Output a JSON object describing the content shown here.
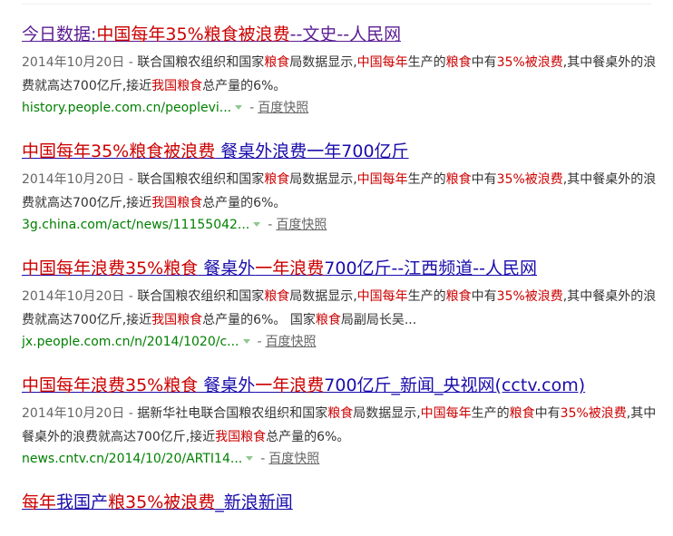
{
  "results": [
    {
      "title_parts": [
        {
          "text": "今日数据:",
          "hl": false
        },
        {
          "text": "中国每年35%粮食被浪费",
          "hl": true
        },
        {
          "text": "--文史--人民网",
          "hl": false
        }
      ],
      "visited": true,
      "abstract_parts": [
        {
          "text": "2014年10月20日 - ",
          "cls": "date"
        },
        {
          "text": "联合国粮农组织和国家",
          "cls": ""
        },
        {
          "text": "粮食",
          "cls": "hl"
        },
        {
          "text": "局数据显示,",
          "cls": ""
        },
        {
          "text": "中国每年",
          "cls": "hl"
        },
        {
          "text": "生产的",
          "cls": ""
        },
        {
          "text": "粮食",
          "cls": "hl"
        },
        {
          "text": "中有",
          "cls": ""
        },
        {
          "text": "35%被浪费",
          "cls": "hl"
        },
        {
          "text": ",其中餐桌外的浪费就高达700亿斤,接近",
          "cls": ""
        },
        {
          "text": "我国粮食",
          "cls": "hl"
        },
        {
          "text": "总产量的6%。",
          "cls": ""
        }
      ],
      "url": "history.people.com.cn/peoplevi...",
      "cache_label": "百度快照"
    },
    {
      "title_parts": [
        {
          "text": "中国每年35%粮食被浪费",
          "hl": true
        },
        {
          "text": " 餐桌外浪费一年700亿斤",
          "hl": false
        }
      ],
      "visited": false,
      "abstract_parts": [
        {
          "text": "2014年10月20日 - ",
          "cls": "date"
        },
        {
          "text": "联合国粮农组织和国家",
          "cls": ""
        },
        {
          "text": "粮食",
          "cls": "hl"
        },
        {
          "text": "局数据显示,",
          "cls": ""
        },
        {
          "text": "中国每年",
          "cls": "hl"
        },
        {
          "text": "生产的",
          "cls": ""
        },
        {
          "text": "粮食",
          "cls": "hl"
        },
        {
          "text": "中有",
          "cls": ""
        },
        {
          "text": "35%被浪费",
          "cls": "hl"
        },
        {
          "text": ",其中餐桌外的浪费就高达700亿斤,接近",
          "cls": ""
        },
        {
          "text": "我国粮食",
          "cls": "hl"
        },
        {
          "text": "总产量的6%。",
          "cls": ""
        }
      ],
      "url": "3g.china.com/act/news/11155042...",
      "cache_label": "百度快照"
    },
    {
      "title_parts": [
        {
          "text": "中国每年浪费35%粮食",
          "hl": true
        },
        {
          "text": " 餐桌外",
          "hl": false
        },
        {
          "text": "一年浪费",
          "hl": true
        },
        {
          "text": "700亿斤--江西频道--人民网",
          "hl": false
        }
      ],
      "visited": false,
      "abstract_parts": [
        {
          "text": "2014年10月20日 - ",
          "cls": "date"
        },
        {
          "text": "联合国粮农组织和国家",
          "cls": ""
        },
        {
          "text": "粮食",
          "cls": "hl"
        },
        {
          "text": "局数据显示,",
          "cls": ""
        },
        {
          "text": "中国每年",
          "cls": "hl"
        },
        {
          "text": "生产的",
          "cls": ""
        },
        {
          "text": "粮食",
          "cls": "hl"
        },
        {
          "text": "中有",
          "cls": ""
        },
        {
          "text": "35%被浪费",
          "cls": "hl"
        },
        {
          "text": ",其中餐桌外的浪费就高达700亿斤,接近",
          "cls": ""
        },
        {
          "text": "我国粮食",
          "cls": "hl"
        },
        {
          "text": "总产量的6%。 国家",
          "cls": ""
        },
        {
          "text": "粮食",
          "cls": "hl"
        },
        {
          "text": "局副局长吴...",
          "cls": ""
        }
      ],
      "url": "jx.people.com.cn/n/2014/1020/c...",
      "cache_label": "百度快照"
    },
    {
      "title_parts": [
        {
          "text": "中国每年浪费35%粮食",
          "hl": true
        },
        {
          "text": " 餐桌外",
          "hl": false
        },
        {
          "text": "一年浪费",
          "hl": true
        },
        {
          "text": "700亿斤_新闻_央视网(cctv.com)",
          "hl": false
        }
      ],
      "visited": false,
      "abstract_parts": [
        {
          "text": "2014年10月20日 - ",
          "cls": "date"
        },
        {
          "text": "据新华社电联合国粮农组织和国家",
          "cls": ""
        },
        {
          "text": "粮食",
          "cls": "hl"
        },
        {
          "text": "局数据显示,",
          "cls": ""
        },
        {
          "text": "中国每年",
          "cls": "hl"
        },
        {
          "text": "生产的",
          "cls": ""
        },
        {
          "text": "粮食",
          "cls": "hl"
        },
        {
          "text": "中有",
          "cls": ""
        },
        {
          "text": "35%被浪费",
          "cls": "hl"
        },
        {
          "text": ",其中餐桌外的浪费就高达700亿斤,接近",
          "cls": ""
        },
        {
          "text": "我国粮食",
          "cls": "hl"
        },
        {
          "text": "总产量的6%。",
          "cls": ""
        }
      ],
      "url": "news.cntv.cn/2014/10/20/ARTI14...",
      "cache_label": "百度快照"
    },
    {
      "title_parts": [
        {
          "text": "每年",
          "hl": true
        },
        {
          "text": "我国产",
          "hl": false
        },
        {
          "text": "粮35%被浪费",
          "hl": true
        },
        {
          "text": "_新浪新闻",
          "hl": false
        }
      ],
      "visited": false,
      "abstract_parts": [],
      "url": "",
      "cache_label": ""
    }
  ]
}
